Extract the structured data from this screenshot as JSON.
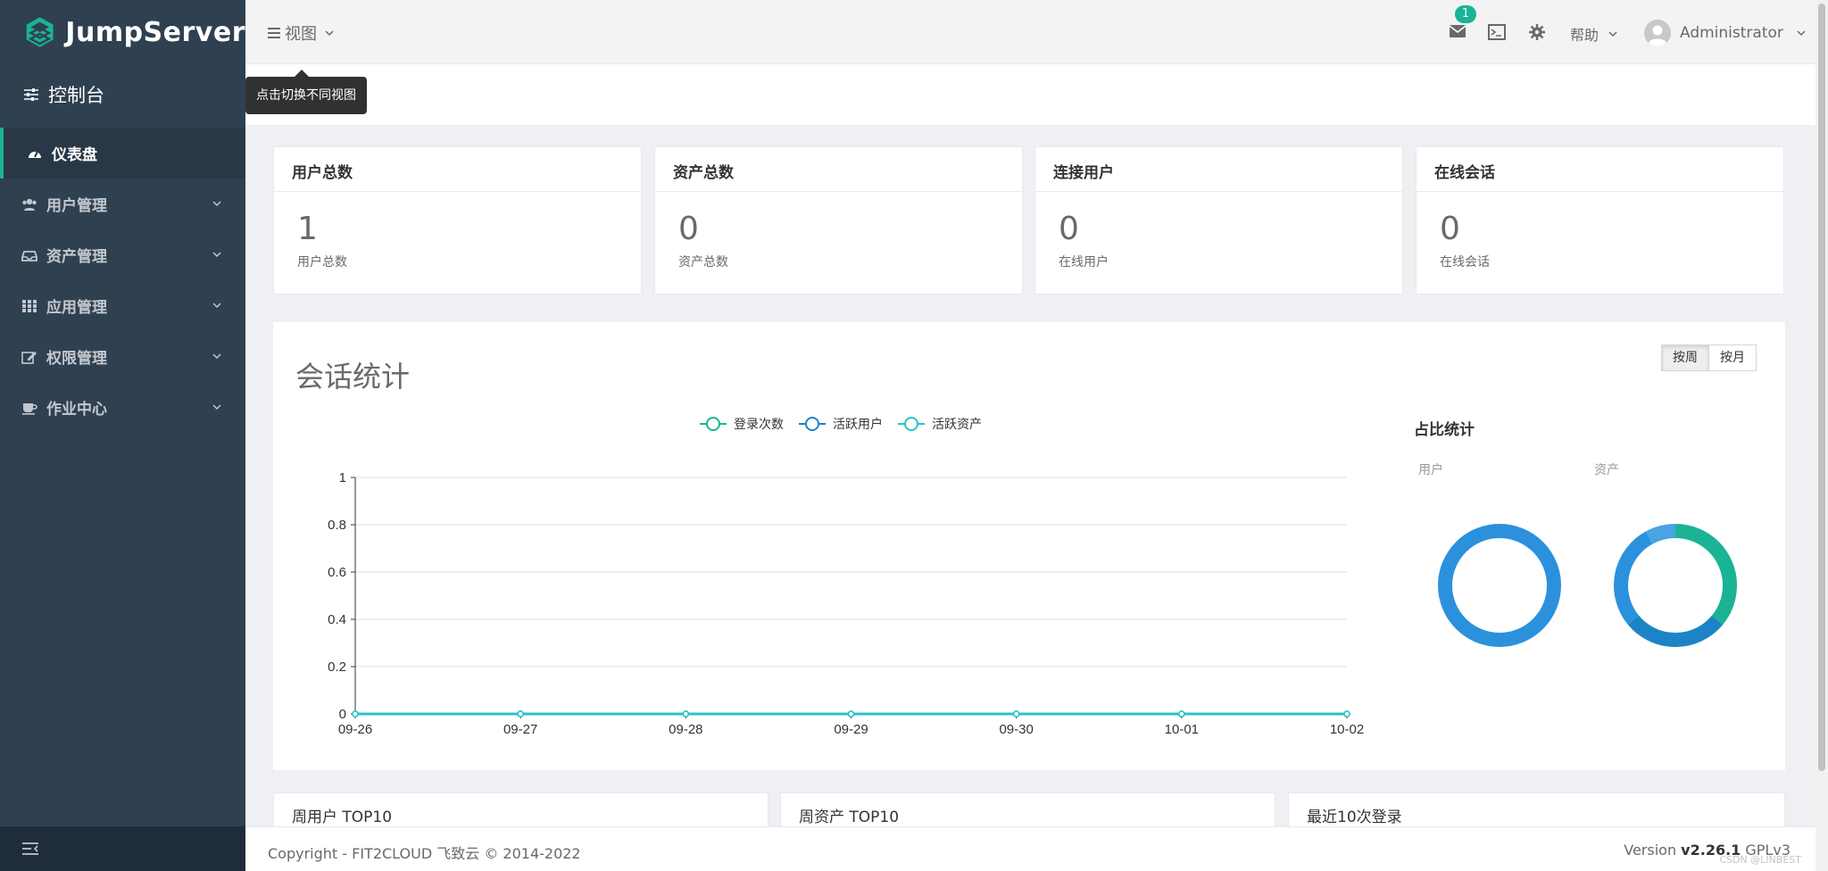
{
  "app": {
    "brand": "JumpServer",
    "console_label": "控制台"
  },
  "sidebar": {
    "items": [
      {
        "label": "仪表盘",
        "icon": "dashboard-icon",
        "active": true
      },
      {
        "label": "用户管理",
        "icon": "users-icon"
      },
      {
        "label": "资产管理",
        "icon": "inbox-icon"
      },
      {
        "label": "应用管理",
        "icon": "grid-icon"
      },
      {
        "label": "权限管理",
        "icon": "edit-icon"
      },
      {
        "label": "作业中心",
        "icon": "coffee-icon"
      }
    ]
  },
  "topbar": {
    "view_label": "视图",
    "view_tooltip": "点击切换不同视图",
    "mail_badge": "1",
    "help_label": "帮助",
    "username": "Administrator"
  },
  "cards": [
    {
      "title": "用户总数",
      "value": "1",
      "label": "用户总数"
    },
    {
      "title": "资产总数",
      "value": "0",
      "label": "资产总数"
    },
    {
      "title": "连接用户",
      "value": "0",
      "label": "在线用户"
    },
    {
      "title": "在线会话",
      "value": "0",
      "label": "在线会话"
    }
  ],
  "session": {
    "title": "会话统计",
    "toggle": [
      "按周",
      "按月"
    ],
    "share_title": "占比统计",
    "pie_labels": [
      "用户",
      "资产"
    ]
  },
  "chart_data": [
    {
      "type": "line",
      "x": [
        "09-26",
        "09-27",
        "09-28",
        "09-29",
        "09-30",
        "10-01",
        "10-02"
      ],
      "series": [
        {
          "name": "登录次数",
          "values": [
            0,
            0,
            0,
            0,
            0,
            0,
            0
          ]
        },
        {
          "name": "活跃用户",
          "values": [
            0,
            0,
            0,
            0,
            0,
            0,
            0
          ]
        },
        {
          "name": "活跃资产",
          "values": [
            0,
            0,
            0,
            0,
            0,
            0,
            0
          ]
        }
      ],
      "yticks": [
        "0",
        "0.2",
        "0.4",
        "0.6",
        "0.8",
        "1"
      ],
      "ylim": [
        0,
        1
      ],
      "legend": "top-center",
      "colors": [
        "#1ab394",
        "#1c84c6",
        "#23c6c8"
      ]
    },
    {
      "type": "pie",
      "label": "用户",
      "slices": [
        {
          "value": 1
        }
      ],
      "colors": [
        "#2b91dc"
      ]
    },
    {
      "type": "pie",
      "label": "资产",
      "slices": [
        {
          "value": 0.36
        },
        {
          "value": 0.28
        },
        {
          "value": 0.28
        },
        {
          "value": 0.08
        }
      ],
      "colors": [
        "#1ab394",
        "#1c84c6",
        "#2b91dc",
        "#4aa3e3"
      ]
    }
  ],
  "bottom_cards": [
    "周用户 TOP10",
    "周资产 TOP10",
    "最近10次登录"
  ],
  "footer": {
    "copyright": "Copyright - FIT2CLOUD 飞致云 © 2014-2022",
    "version_prefix": "Version ",
    "version": "v2.26.1",
    "license": " GPLv3",
    "watermark": "CSDN @LINBEST"
  },
  "colors": {
    "sidebar_bg": "#2f4050",
    "accent": "#1ab394"
  }
}
